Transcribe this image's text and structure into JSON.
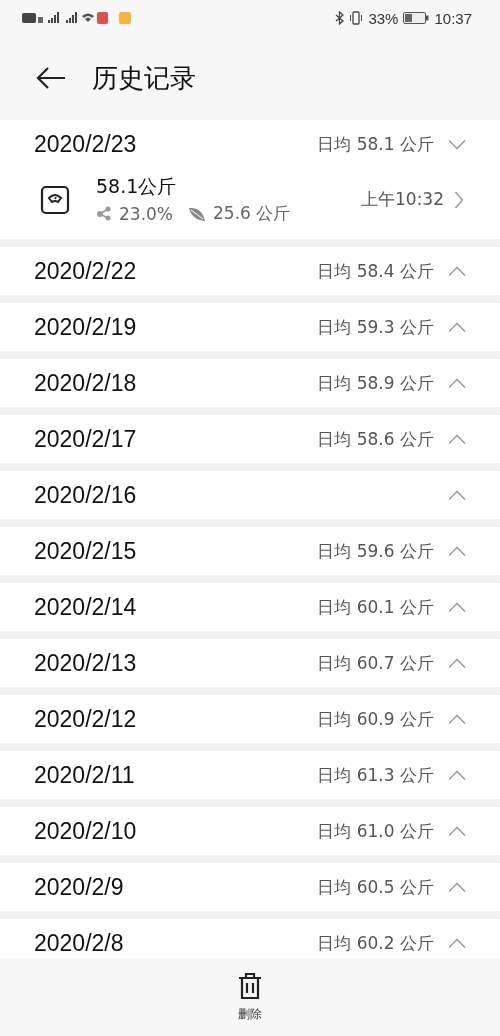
{
  "status_bar": {
    "battery": "33%",
    "time": "10:37"
  },
  "header": {
    "title": "历史记录"
  },
  "days": [
    {
      "date": "2020/2/23",
      "average": "日均 58.1 公斤",
      "expanded": true,
      "records": [
        {
          "weight": "58.1公斤",
          "body_fat": "23.0%",
          "muscle": "25.6 公斤",
          "time": "上午10:32"
        }
      ]
    },
    {
      "date": "2020/2/22",
      "average": "日均 58.4 公斤",
      "expanded": false
    },
    {
      "date": "2020/2/19",
      "average": "日均 59.3 公斤",
      "expanded": false
    },
    {
      "date": "2020/2/18",
      "average": "日均 58.9 公斤",
      "expanded": false
    },
    {
      "date": "2020/2/17",
      "average": "日均 58.6 公斤",
      "expanded": false
    },
    {
      "date": "2020/2/16",
      "expanded": false
    },
    {
      "date": "2020/2/15",
      "average": "日均 59.6 公斤",
      "expanded": false
    },
    {
      "date": "2020/2/14",
      "average": "日均 60.1 公斤",
      "expanded": false
    },
    {
      "date": "2020/2/13",
      "average": "日均 60.7 公斤",
      "expanded": false
    },
    {
      "date": "2020/2/12",
      "average": "日均 60.9 公斤",
      "expanded": false
    },
    {
      "date": "2020/2/11",
      "average": "日均 61.3 公斤",
      "expanded": false
    },
    {
      "date": "2020/2/10",
      "average": "日均 61.0 公斤",
      "expanded": false
    },
    {
      "date": "2020/2/9",
      "average": "日均 60.5 公斤",
      "expanded": false
    },
    {
      "date": "2020/2/8",
      "average": "日均 60.2 公斤",
      "expanded": false
    }
  ],
  "bottom_bar": {
    "delete_label": "删除"
  }
}
